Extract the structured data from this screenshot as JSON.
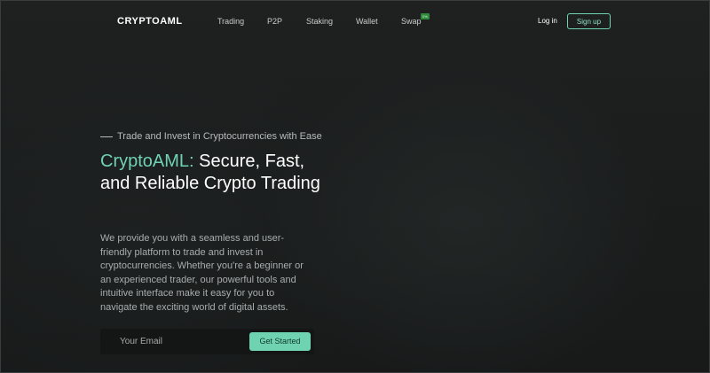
{
  "header": {
    "logo": "CRYPTOAML",
    "nav": {
      "trading": "Trading",
      "p2p": "P2P",
      "staking": "Staking",
      "wallet": "Wallet",
      "swap": "Swap",
      "swap_badge": "0%"
    },
    "login": "Log in",
    "signup": "Sign up"
  },
  "hero": {
    "eyebrow": "Trade and Invest in Cryptocurrencies with Ease",
    "headline_brand": "CryptoAML:",
    "headline_rest": " Secure, Fast, and Reliable Crypto Trading",
    "description": "We provide you with a seamless and user-friendly platform to trade and invest in cryptocurrencies. Whether you're a beginner or an experienced trader, our powerful tools and intuitive interface make it easy for you to navigate the exciting world of digital assets.",
    "email_placeholder": "Your Email",
    "cta": "Get Started"
  },
  "colors": {
    "accent": "#6fd3b2",
    "background": "#1a1c1c",
    "badge": "#2f8a3d"
  }
}
